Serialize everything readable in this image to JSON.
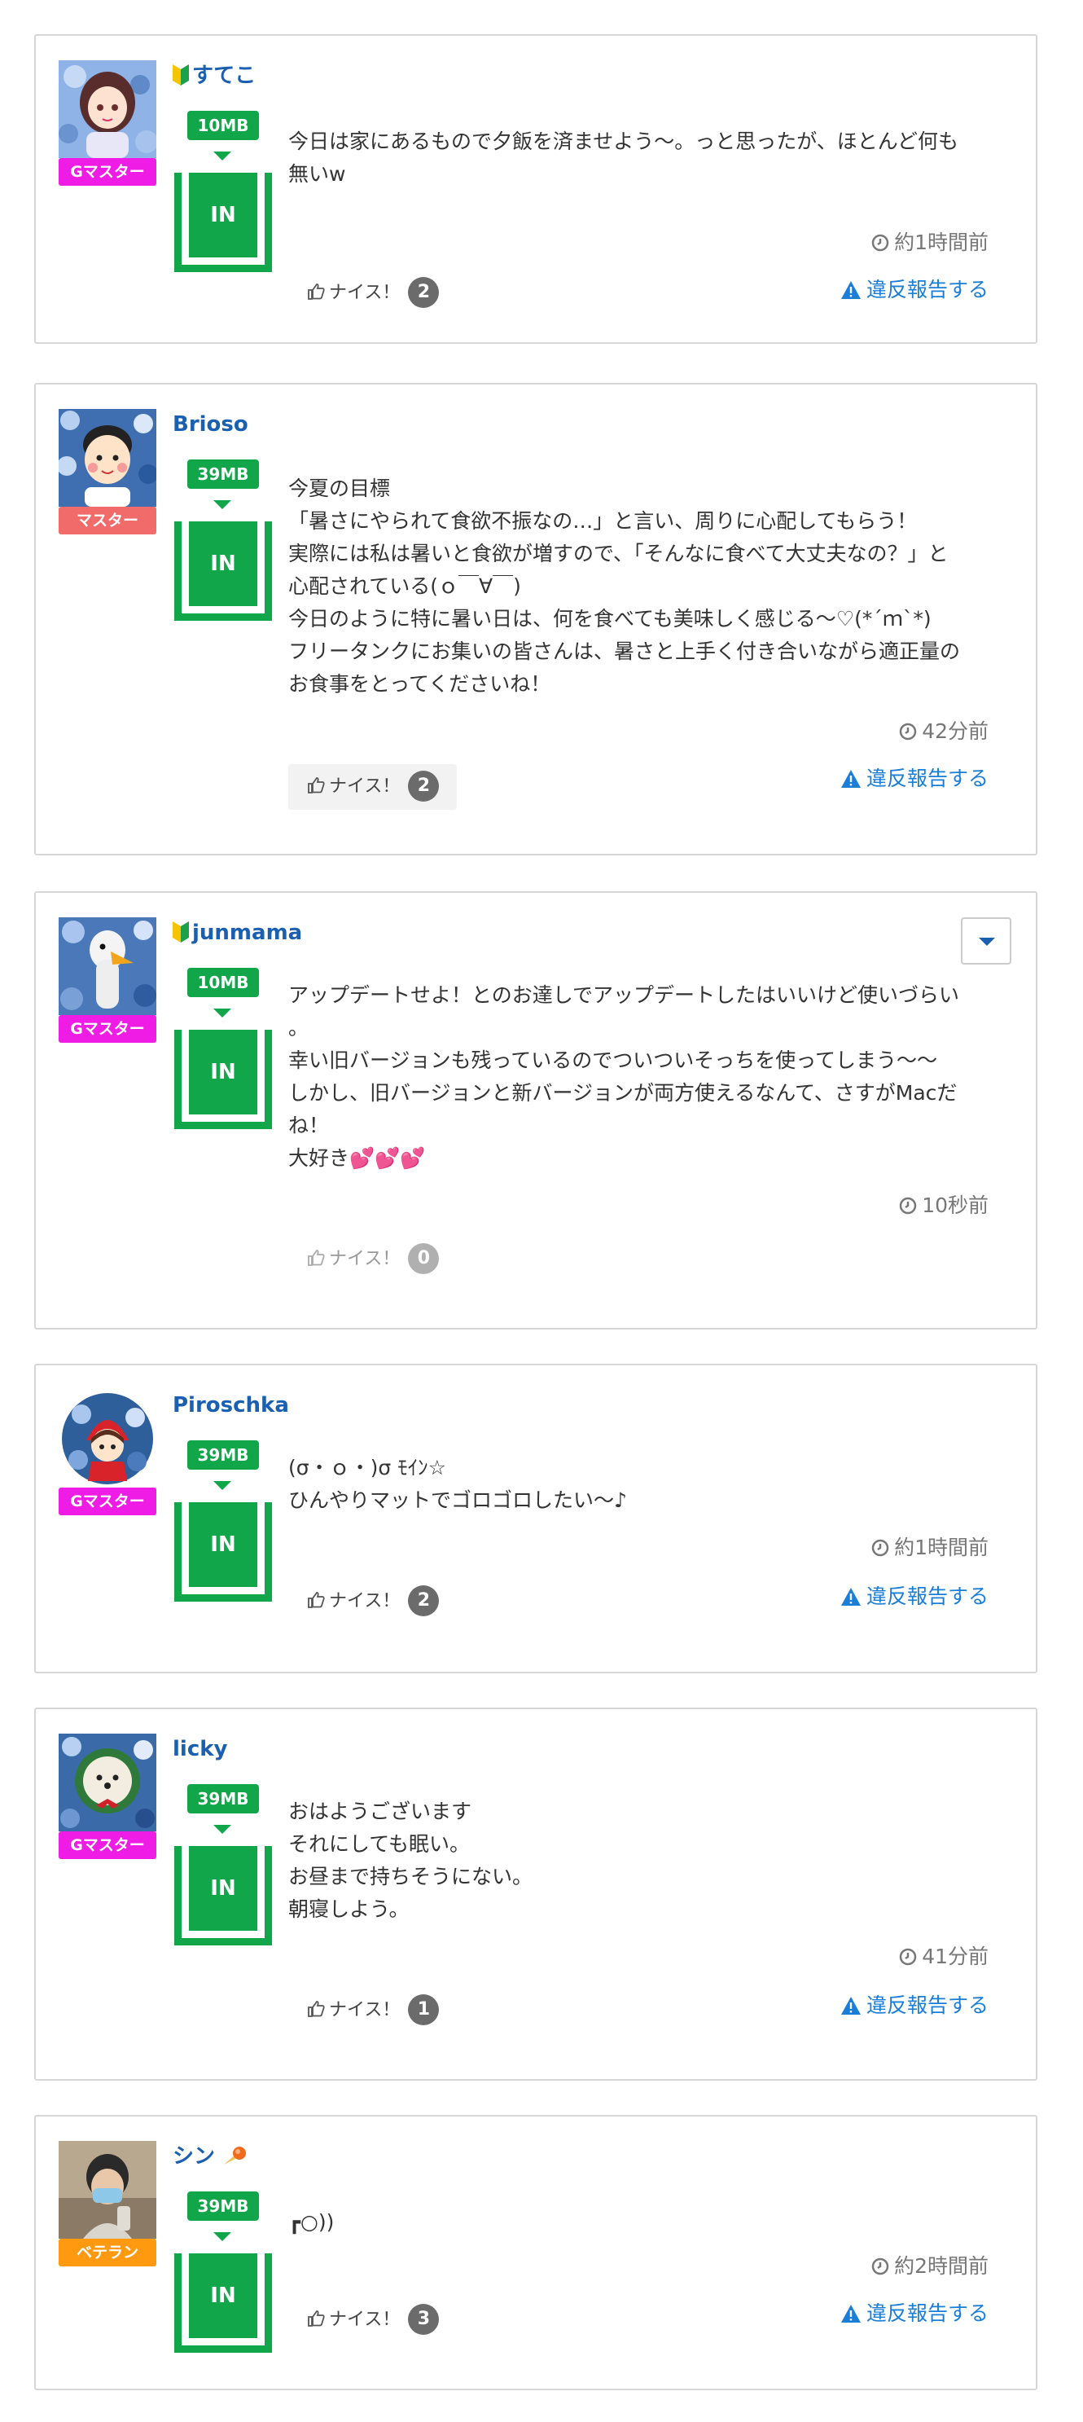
{
  "common": {
    "in_label": "IN",
    "nice_label": "ナイス！",
    "report_label": "違反報告する"
  },
  "colors": {
    "green": "#12a64a",
    "link_blue": "#1b7ed6",
    "name_blue": "#1b5fb0",
    "rank_g": "#ee1ce4",
    "rank_master": "#f26b6b",
    "rank_veteran": "#ff9a10"
  },
  "posts": [
    {
      "name": "すてこ",
      "beginner_mark": true,
      "rank": "Gマスター",
      "mb": "10MB",
      "message": "今日は家にあるもので夕飯を済ませよう〜。っと思ったが、ほとんど何も\n無いw",
      "time": "約1時間前",
      "nice_count": "2",
      "has_report": true,
      "has_dropdown": false
    },
    {
      "name": "Brioso",
      "beginner_mark": false,
      "rank": "マスター",
      "mb": "39MB",
      "message": "今夏の目標\n「暑さにやられて食欲不振なの…」と言い、周りに心配してもらう！\n実際には私は暑いと食欲が増すので、「そんなに食べて大丈夫なの？」と\n心配されている(ｏ￣∀￣)\n今日のように特に暑い日は、何を食べても美味しく感じる〜♡(*´ｍ`*)\nフリータンクにお集いの皆さんは、暑さと上手く付き合いながら適正量の\nお食事をとってくださいね！",
      "time": "42分前",
      "nice_count": "2",
      "has_report": true,
      "has_dropdown": false
    },
    {
      "name": "junmama",
      "beginner_mark": true,
      "rank": "Gマスター",
      "mb": "10MB",
      "message": "アップデートせよ！とのお達しでアップデートしたはいいけど使いづらい\n。\n幸い旧バージョンも残っているのでついついそっちを使ってしまう〜〜\nしかし、旧バージョンと新バージョンが両方使えるなんて、さすがMacだ\nね！\n大好き💕💕💕",
      "time": "10秒前",
      "nice_count": "0",
      "has_report": false,
      "has_dropdown": true
    },
    {
      "name": "Piroschka",
      "beginner_mark": false,
      "rank": "Gマスター",
      "mb": "39MB",
      "message": "(σ・ｏ・)σ ﾓｲﾝ☆\nひんやりマットでゴロゴロしたい〜♪",
      "time": "約1時間前",
      "nice_count": "2",
      "has_report": true,
      "has_dropdown": false
    },
    {
      "name": "licky",
      "beginner_mark": false,
      "rank": "Gマスター",
      "mb": "39MB",
      "message": "おはようございます\nそれにしても眠い。\nお昼まで持ちそうにない。\n朝寝しよう。",
      "time": "41分前",
      "nice_count": "1",
      "has_report": true,
      "has_dropdown": false
    },
    {
      "name": "シン",
      "beginner_mark": false,
      "rank": "ベテラン",
      "mb": "39MB",
      "message": "┏○))",
      "time": "約2時間前",
      "nice_count": "3",
      "has_report": true,
      "has_dropdown": false
    }
  ]
}
